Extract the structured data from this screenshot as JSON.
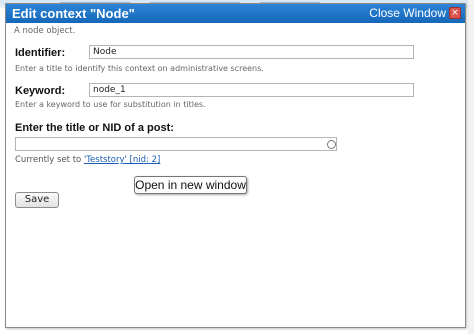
{
  "dialog": {
    "title": "Edit context \"Node\"",
    "close_label": "Close Window",
    "description": "A node object."
  },
  "identifier": {
    "label": "Identifier:",
    "value": "Node",
    "help": "Enter a title to identify this context on administrative screens."
  },
  "keyword": {
    "label": "Keyword:",
    "value": "node_1",
    "help": "Enter a keyword to use for substitution in titles."
  },
  "post": {
    "label": "Enter the title or NID of a post:",
    "value": "",
    "current_prefix": "Currently set to ",
    "current_link": "'Teststory' [nid: 2]"
  },
  "save_label": "Save",
  "tooltip": "Open in new window",
  "colors": {
    "titlebar": "#1a6fc4",
    "link": "#1a5db3",
    "close_icon": "#d9534f"
  }
}
